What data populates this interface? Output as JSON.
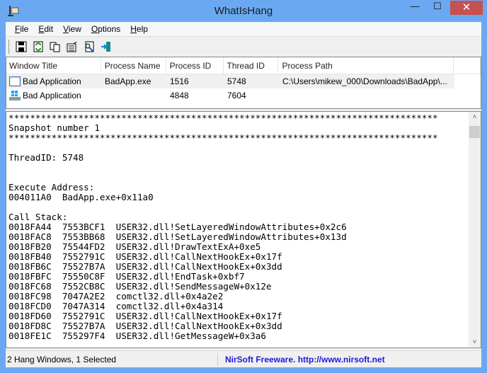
{
  "window": {
    "title": "WhatIsHang",
    "minimize": "—",
    "maximize": "☐",
    "close": "✕"
  },
  "menu": [
    {
      "label": "File",
      "u": "F",
      "rest": "ile"
    },
    {
      "label": "Edit",
      "u": "E",
      "rest": "dit"
    },
    {
      "label": "View",
      "u": "V",
      "rest": "iew"
    },
    {
      "label": "Options",
      "u": "O",
      "rest": "ptions"
    },
    {
      "label": "Help",
      "u": "H",
      "rest": "elp"
    }
  ],
  "toolbar": [
    "save-icon",
    "refresh-icon",
    "copy-icon",
    "properties-icon",
    "find-icon",
    "exit-icon"
  ],
  "list": {
    "columns": [
      "Window Title",
      "Process Name",
      "Process ID",
      "Thread ID",
      "Process Path"
    ],
    "rows": [
      {
        "title": "Bad Application",
        "process": "BadApp.exe",
        "pid": "1516",
        "tid": "5748",
        "path": "C:\\Users\\mikew_000\\Downloads\\BadApp\\...",
        "selected": true
      },
      {
        "title": "Bad Application",
        "process": "",
        "pid": "4848",
        "tid": "7604",
        "path": "",
        "selected": false
      }
    ]
  },
  "report": {
    "lines": [
      "********************************************************************************",
      "Snapshot number 1",
      "********************************************************************************",
      "",
      "ThreadID: 5748",
      "",
      "",
      "Execute Address:",
      "004011A0  BadApp.exe+0x11a0",
      "",
      "Call Stack:",
      "0018FA44  7553BCF1  USER32.dll!SetLayeredWindowAttributes+0x2c6",
      "0018FAC8  7553BB68  USER32.dll!SetLayeredWindowAttributes+0x13d",
      "0018FB20  75544FD2  USER32.dll!DrawTextExA+0xe5",
      "0018FB40  7552791C  USER32.dll!CallNextHookEx+0x17f",
      "0018FB6C  75527B7A  USER32.dll!CallNextHookEx+0x3dd",
      "0018FBFC  75550C8F  USER32.dll!EndTask+0xbf7",
      "0018FC68  7552CB8C  USER32.dll!SendMessageW+0x12e",
      "0018FC98  7047A2E2  comctl32.dll+0x4a2e2",
      "0018FCD0  7047A314  comctl32.dll+0x4a314",
      "0018FD60  7552791C  USER32.dll!CallNextHookEx+0x17f",
      "0018FD8C  75527B7A  USER32.dll!CallNextHookEx+0x3dd",
      "0018FE1C  755297F4  USER32.dll!GetMessageW+0x3a6"
    ]
  },
  "status": {
    "left": "2 Hang Windows, 1 Selected",
    "right": "NirSoft Freeware.  http://www.nirsoft.net"
  },
  "colors": {
    "frame": "#6aa9f2",
    "close": "#c75050",
    "link": "#1b1bd8"
  }
}
